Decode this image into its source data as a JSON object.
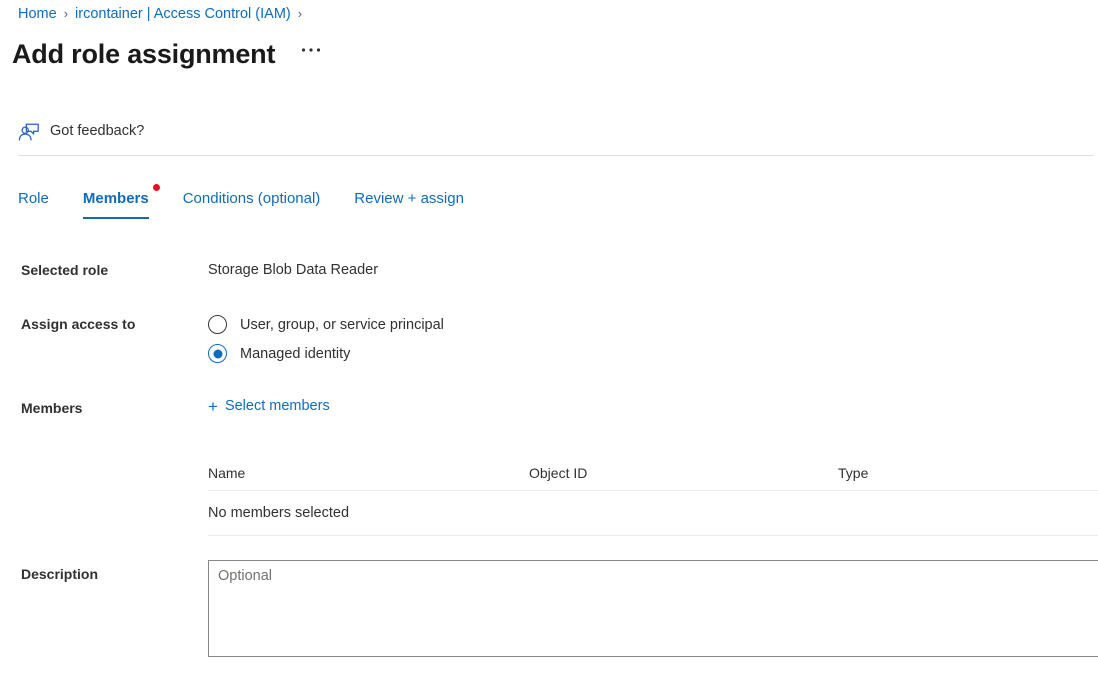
{
  "breadcrumb": {
    "items": [
      {
        "label": "Home"
      },
      {
        "label": "ircontainer | Access Control (IAM)"
      }
    ],
    "separator": "›"
  },
  "header": {
    "title": "Add role assignment",
    "more_label": "• • •",
    "more_icon": "ellipsis-icon"
  },
  "feedback": {
    "icon": "feedback-person-icon",
    "label": "Got feedback?"
  },
  "tabs": [
    {
      "label": "Role",
      "active": false,
      "dot": false
    },
    {
      "label": "Members",
      "active": true,
      "dot": true
    },
    {
      "label": "Conditions (optional)",
      "active": false,
      "dot": false
    },
    {
      "label": "Review + assign",
      "active": false,
      "dot": false
    }
  ],
  "form": {
    "selected_role": {
      "label": "Selected role",
      "value": "Storage Blob Data Reader"
    },
    "assign_access_to": {
      "label": "Assign access to",
      "options": [
        {
          "label": "User, group, or service principal",
          "selected": false
        },
        {
          "label": "Managed identity",
          "selected": true
        }
      ]
    },
    "members": {
      "label": "Members",
      "select_link": "Select members",
      "plus_icon": "plus-icon"
    },
    "description": {
      "label": "Description",
      "placeholder": "Optional",
      "value": ""
    }
  },
  "members_table": {
    "columns": [
      "Name",
      "Object ID",
      "Type"
    ],
    "empty_message": "No members selected",
    "rows": []
  },
  "colors": {
    "accent": "#0f6cbd",
    "alert_dot": "#e81123",
    "text": "#323130",
    "divider": "#e1dfdd"
  }
}
